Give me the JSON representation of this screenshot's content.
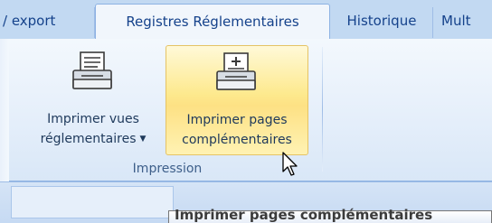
{
  "tabs": [
    {
      "label": "/ export",
      "active": false
    },
    {
      "label": "Registres Réglementaires",
      "active": true
    },
    {
      "label": "Historique",
      "active": false
    },
    {
      "label": "Mult",
      "active": false
    }
  ],
  "ribbon": {
    "group_label": "Impression",
    "buttons": [
      {
        "line1": "Imprimer vues",
        "line2": "réglementaires",
        "has_dropdown": true,
        "icon": "printer-icon"
      },
      {
        "line1": "Imprimer pages",
        "line2": "complémentaires",
        "has_dropdown": false,
        "icon": "printer-add-icon",
        "hovered": true
      }
    ]
  },
  "tooltip": {
    "title": "Imprimer pages complémentaires"
  },
  "colors": {
    "tab_strip": "#c2d9f2",
    "ribbon_bg": "#e4eefa",
    "hover_highlight": "#fde98d",
    "text": "#1e395b"
  }
}
